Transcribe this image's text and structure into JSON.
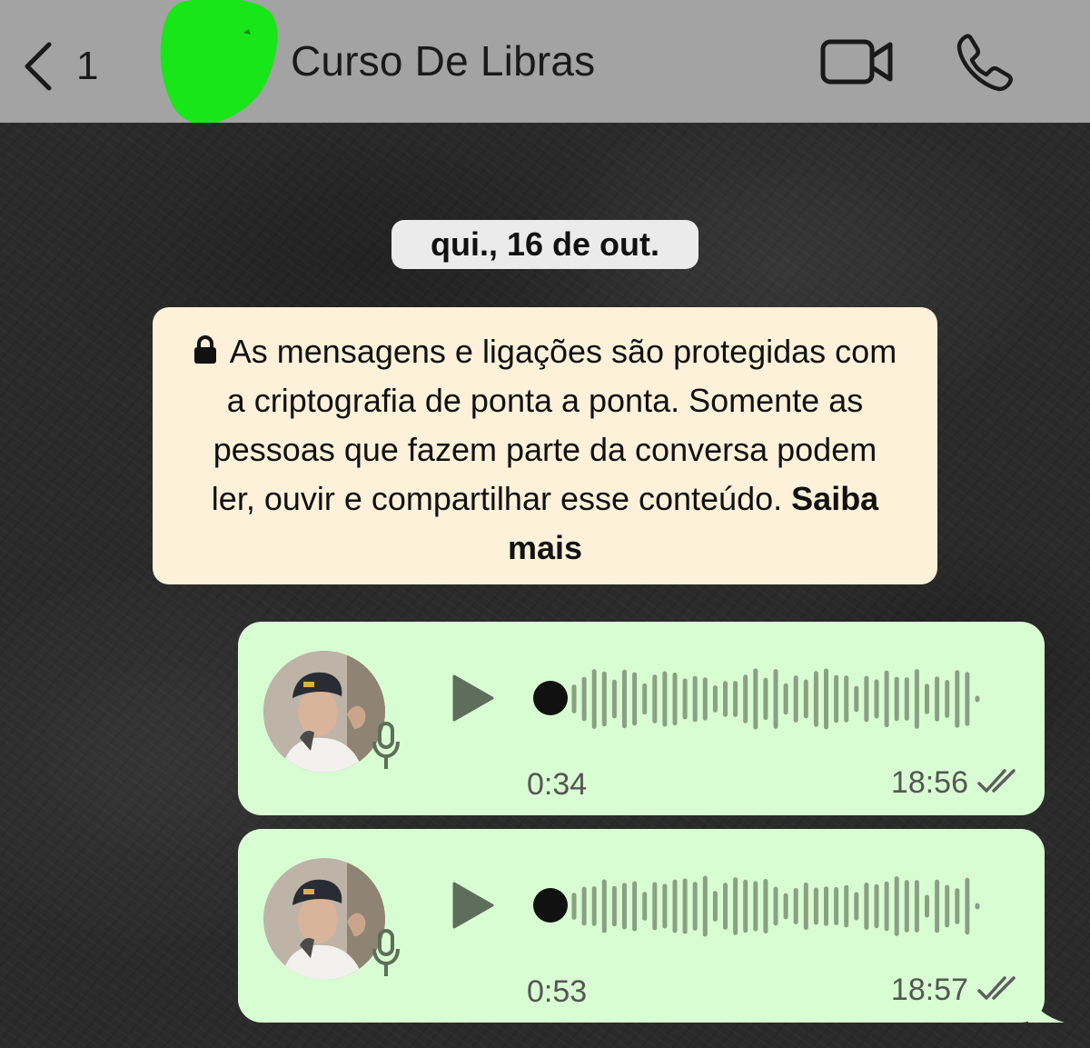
{
  "header": {
    "back_count": "1",
    "title": "Curso De Libras",
    "icons": {
      "back": "chevron-left-icon",
      "video": "video-camera-icon",
      "phone": "phone-icon"
    },
    "background": "#a3a3a3"
  },
  "chat": {
    "date_separator": "qui., 16 de out.",
    "security_notice": {
      "text": "As mensagens e ligações são protegidas com a criptografia de ponta a ponta. Somente as pessoas que fazem parte da conversa podem ler, ouvir e compartilhar esse conteúdo.",
      "link": "Saiba mais",
      "icon": "lock-icon",
      "background": "#fdf1da"
    },
    "messages": [
      {
        "type": "voice",
        "duration": "0:34",
        "time": "18:56",
        "status": "read",
        "icons": [
          "play-icon",
          "microphone-icon",
          "double-check-icon"
        ]
      },
      {
        "type": "voice",
        "duration": "0:53",
        "time": "18:57",
        "status": "read",
        "icons": [
          "play-icon",
          "microphone-icon",
          "double-check-icon"
        ]
      }
    ],
    "bubble_color": "#d9fdd3"
  }
}
